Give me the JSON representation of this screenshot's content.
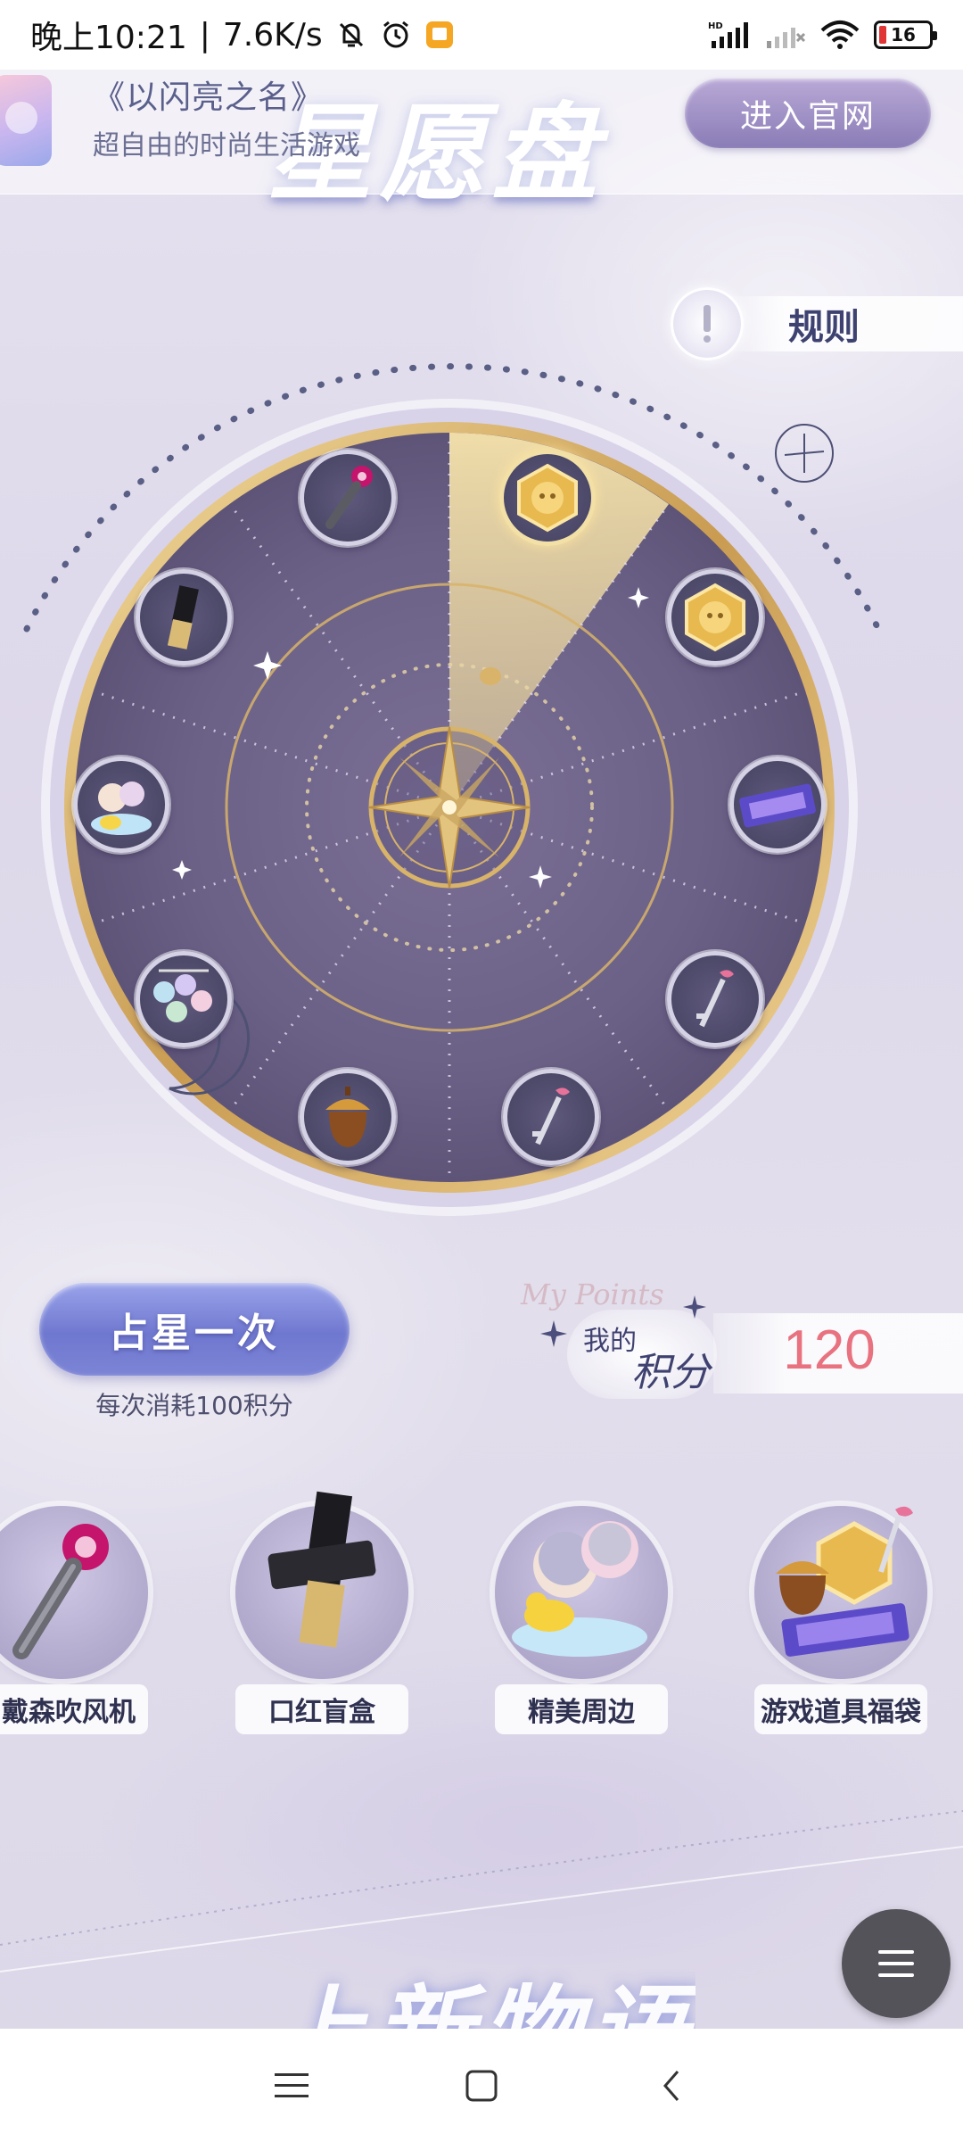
{
  "status_bar": {
    "time": "晚上10:21",
    "net_speed": "7.6K/s",
    "battery": "16"
  },
  "header": {
    "game_title": "《以闪亮之名》",
    "game_slogan": "超自由的时尚生活游戏",
    "page_title": "星愿盘",
    "official_button": "进入官网"
  },
  "rules": {
    "label": "规则"
  },
  "wheel": {
    "selected_index": 0,
    "prizes": [
      {
        "name": "gold-coin-badge",
        "icon": "coin-icon"
      },
      {
        "name": "gold-coin-badge",
        "icon": "coin-icon"
      },
      {
        "name": "ticket",
        "icon": "ticket-icon"
      },
      {
        "name": "pink-key",
        "icon": "key-icon"
      },
      {
        "name": "pink-key",
        "icon": "key-icon"
      },
      {
        "name": "acorn",
        "icon": "acorn-icon"
      },
      {
        "name": "charm-keychain",
        "icon": "keychain-icon"
      },
      {
        "name": "acrylic-stand",
        "icon": "figure-icon"
      },
      {
        "name": "lipstick",
        "icon": "lipstick-icon"
      },
      {
        "name": "hair-dryer",
        "icon": "hair-dryer-icon"
      }
    ]
  },
  "draw": {
    "button_label": "占星一次",
    "cost_text": "每次消耗100积分"
  },
  "points": {
    "en_label": "My Points",
    "label_1": "我的",
    "label_2": "积分",
    "value": "120"
  },
  "showcase": [
    {
      "label": "戴森吹风机",
      "icon": "hair-dryer-icon"
    },
    {
      "label": "口红盲盒",
      "icon": "lipstick-icon"
    },
    {
      "label": "精美周边",
      "icon": "figure-icon"
    },
    {
      "label": "游戏道具福袋",
      "icon": "gift-bag-icon"
    }
  ],
  "teaser_title": "上新物语",
  "colors": {
    "accent_purple": "#6f78cf",
    "points_pink": "#e8727f",
    "wheel_dark": "#5e567a",
    "gold": "#d8b36a"
  }
}
